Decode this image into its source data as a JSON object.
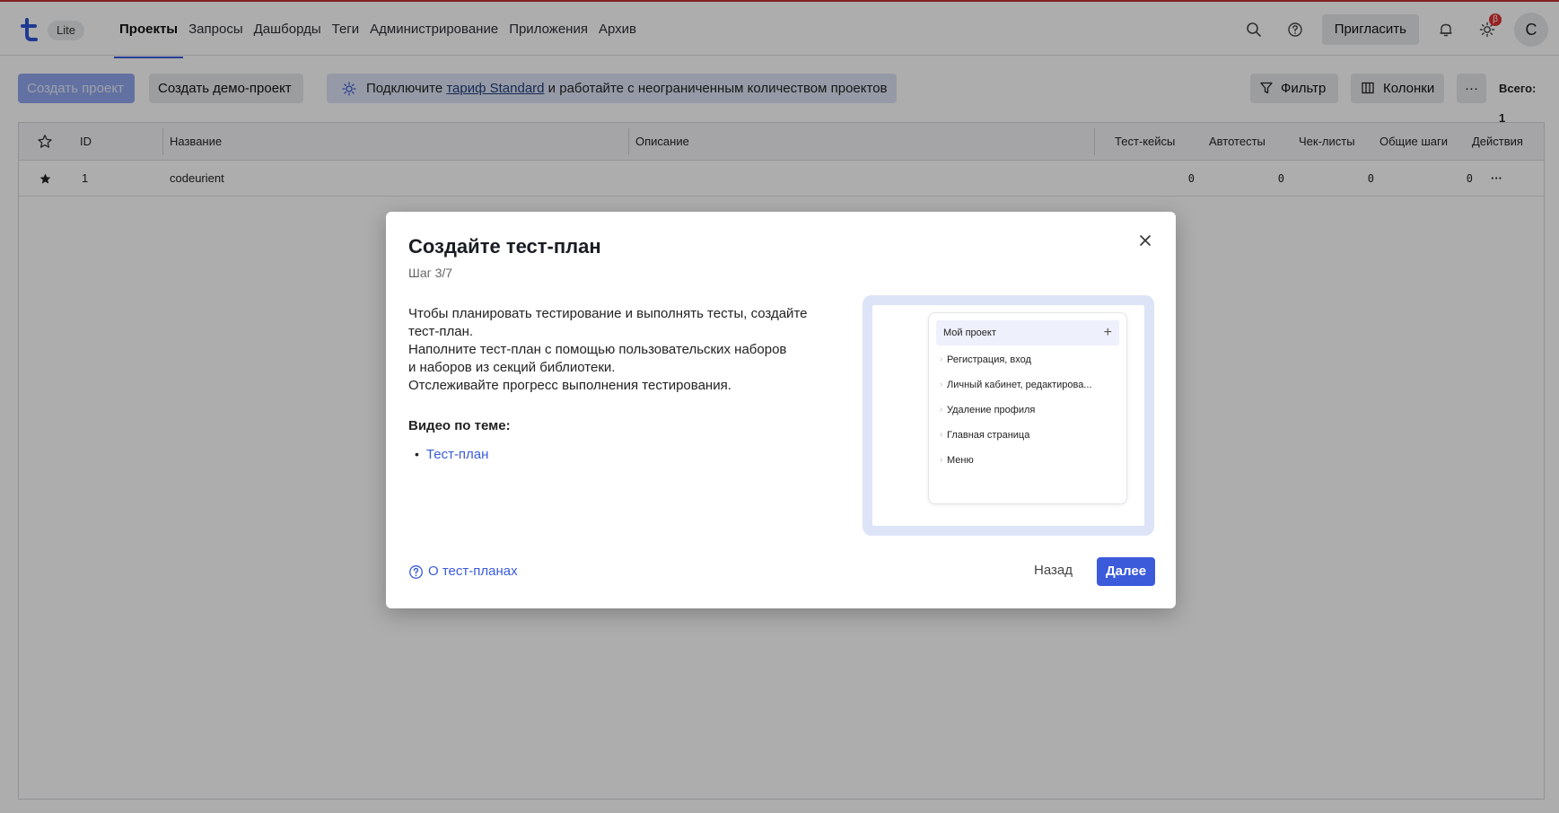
{
  "header": {
    "lite_badge": "Lite",
    "nav": [
      "Проекты",
      "Запросы",
      "Дашборды",
      "Теги",
      "Администрирование",
      "Приложения",
      "Архив"
    ],
    "invite_label": "Пригласить",
    "beta_badge": "β",
    "avatar_initial": "C"
  },
  "toolbar": {
    "create_project": "Создать проект",
    "create_demo": "Создать демо-проект",
    "promo_before": "Подключите ",
    "promo_link": "тариф Standard",
    "promo_after": " и работайте с неограниченным количеством проектов",
    "filter": "Фильтр",
    "columns": "Колонки",
    "more": "···",
    "total": "Всего: 1"
  },
  "table": {
    "headers": {
      "id": "ID",
      "name": "Название",
      "description": "Описание",
      "test_cases": "Тест-кейсы",
      "autotests": "Автотесты",
      "checklists": "Чек-листы",
      "shared_steps": "Общие шаги",
      "actions": "Действия"
    },
    "rows": [
      {
        "id": "1",
        "name": "codeurient",
        "description": "",
        "test_cases": "0",
        "autotests": "0",
        "checklists": "0",
        "shared_steps": "0",
        "actions": "···"
      }
    ]
  },
  "modal": {
    "title": "Создайте тест-план",
    "step": "Шаг 3/7",
    "body": [
      "Чтобы планировать тестирование и выполнять тесты, создайте",
      "тест-план.",
      "Наполните тест-план с помощью пользовательских наборов",
      "и наборов из секций библиотеки.",
      "Отслеживайте прогресс выполнения тестирования."
    ],
    "video_title": "Видео по теме:",
    "video_link": "Тест-план",
    "illustration": {
      "project": "Мой проект",
      "items": [
        "Регистрация, вход",
        "Личный кабинет, редактирова...",
        "Удаление профиля",
        "Главная страница",
        "Меню"
      ]
    },
    "help_link": "О тест-планах",
    "back": "Назад",
    "next": "Далее"
  },
  "colors": {
    "accent": "#3b5bdb",
    "overlay": "rgba(0,0,0,0.32)"
  }
}
